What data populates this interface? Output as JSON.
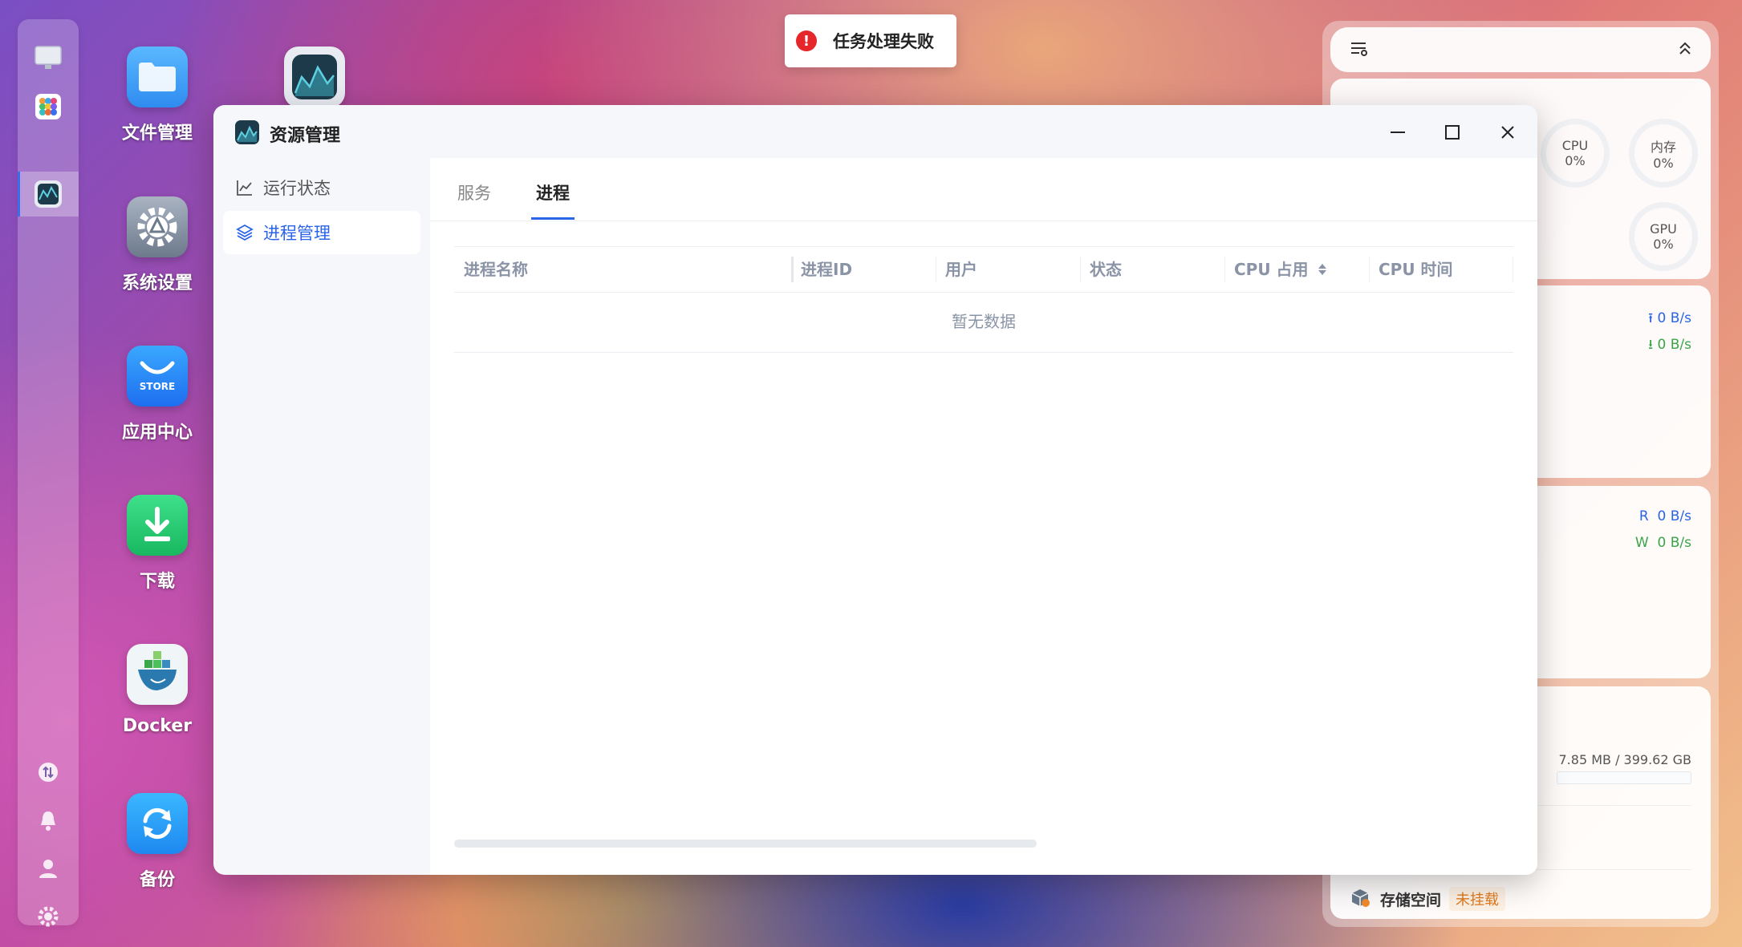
{
  "toast": {
    "message": "任务处理失败",
    "icon": "error-icon"
  },
  "desktop": {
    "icons": [
      {
        "label": "文件管理",
        "icon": "folder-icon"
      },
      {
        "label": "系统设置",
        "icon": "settings-icon"
      },
      {
        "label": "应用中心",
        "icon": "store-icon",
        "badge": "STORE"
      },
      {
        "label": "下载",
        "icon": "download-icon"
      },
      {
        "label": "Docker",
        "icon": "docker-icon"
      },
      {
        "label": "备份",
        "icon": "backup-icon"
      }
    ]
  },
  "window": {
    "title": "资源管理",
    "sidebar": [
      {
        "label": "运行状态",
        "icon": "chart-icon"
      },
      {
        "label": "进程管理",
        "icon": "layers-icon",
        "active": true
      }
    ],
    "tabs": [
      {
        "label": "服务"
      },
      {
        "label": "进程",
        "active": true
      }
    ],
    "table": {
      "columns": [
        "进程名称",
        "进程ID",
        "用户",
        "状态",
        "CPU 占用",
        "CPU 时间"
      ],
      "empty_text": "暂无数据"
    }
  },
  "widget": {
    "gauges": [
      {
        "label": "CPU",
        "value": "0%"
      },
      {
        "label": "内存",
        "value": "0%"
      },
      {
        "label": "GPU",
        "value": "0%"
      }
    ],
    "network": {
      "up": "0 B/s",
      "down": "0 B/s"
    },
    "disk": {
      "read_label": "R",
      "read": "0 B/s",
      "write_label": "W",
      "write": "0 B/s"
    },
    "storage": {
      "usage": "7.85 MB / 399.62 GB",
      "label": "存储空间",
      "status": "未挂载"
    }
  },
  "colors": {
    "accent": "#2a64e8",
    "error": "#e5262b",
    "up": "#2a64e8",
    "down": "#3aa44a",
    "warning": "#e07a1f"
  }
}
